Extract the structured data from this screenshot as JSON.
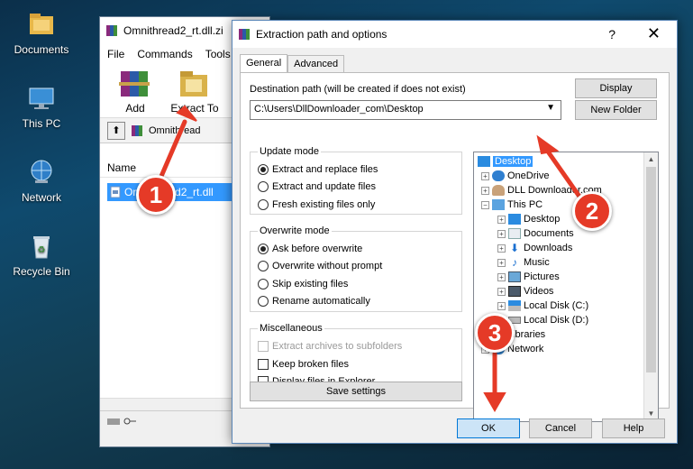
{
  "desktop": {
    "icons": [
      {
        "label": "Documents",
        "icon": "folder-icon"
      },
      {
        "label": "This PC",
        "icon": "computer-icon"
      },
      {
        "label": "Network",
        "icon": "network-icon"
      },
      {
        "label": "Recycle Bin",
        "icon": "recycle-bin-icon"
      }
    ]
  },
  "winrar": {
    "title": "Omnithread2_rt.dll.zi",
    "menu": [
      "File",
      "Commands",
      "Tools"
    ],
    "toolbar": {
      "add": "Add",
      "extract_to": "Extract To",
      "third": "T"
    },
    "path": "Omnithread",
    "column_name": "Name",
    "file": "Omnithread2_rt.dll"
  },
  "dialog": {
    "title": "Extraction path and options",
    "help": "?",
    "close": "✕",
    "tabs": [
      "General",
      "Advanced"
    ],
    "destination_label": "Destination path (will be created if does not exist)",
    "destination_value": "C:\\Users\\DllDownloader_com\\Desktop",
    "display_button": "Display",
    "new_folder_button": "New Folder",
    "update_mode": {
      "title": "Update mode",
      "options": [
        "Extract and replace files",
        "Extract and update files",
        "Fresh existing files only"
      ],
      "selected": 0
    },
    "overwrite_mode": {
      "title": "Overwrite mode",
      "options": [
        "Ask before overwrite",
        "Overwrite without prompt",
        "Skip existing files",
        "Rename automatically"
      ],
      "selected": 0
    },
    "misc": {
      "title": "Miscellaneous",
      "options": [
        "Extract archives to subfolders",
        "Keep broken files",
        "Display files in Explorer"
      ]
    },
    "save_settings": "Save settings",
    "tree": [
      "Desktop",
      "OneDrive",
      "DLL Downloader.com",
      "This PC",
      "Desktop",
      "Documents",
      "Downloads",
      "Music",
      "Pictures",
      "Videos",
      "Local Disk (C:)",
      "Local Disk (D:)",
      "Libraries",
      "Network"
    ],
    "ok": "OK",
    "cancel": "Cancel",
    "help_button": "Help"
  },
  "annotations": {
    "step1": "1",
    "step2": "2",
    "step3": "3"
  },
  "colors": {
    "selection": "#3399ff",
    "callout": "#e53a27"
  }
}
